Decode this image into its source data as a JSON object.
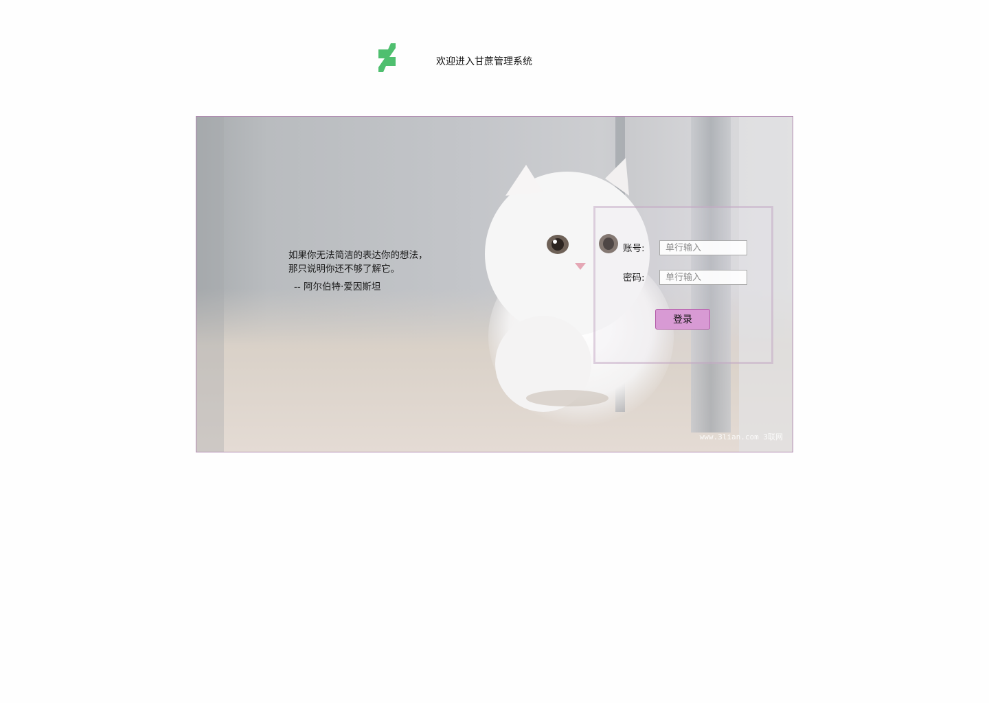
{
  "header": {
    "logo_icon": "deviantart-logo-icon",
    "logo_color": "#4fbf6f",
    "title": "欢迎进入甘蔗管理系统"
  },
  "banner": {
    "quote_text": "如果你无法简洁的表达你的想法，那只说明你还不够了解它。",
    "quote_author": "-- 阿尔伯特·爱因斯坦",
    "watermark": "www.3lian.com 3联网"
  },
  "login": {
    "account_label": "账号:",
    "account_placeholder": "单行输入",
    "account_value": "",
    "password_label": "密码:",
    "password_placeholder": "单行输入",
    "password_value": "",
    "submit_label": "登录",
    "button_color": "#d89ad4",
    "panel_border_color": "#b088b0"
  }
}
